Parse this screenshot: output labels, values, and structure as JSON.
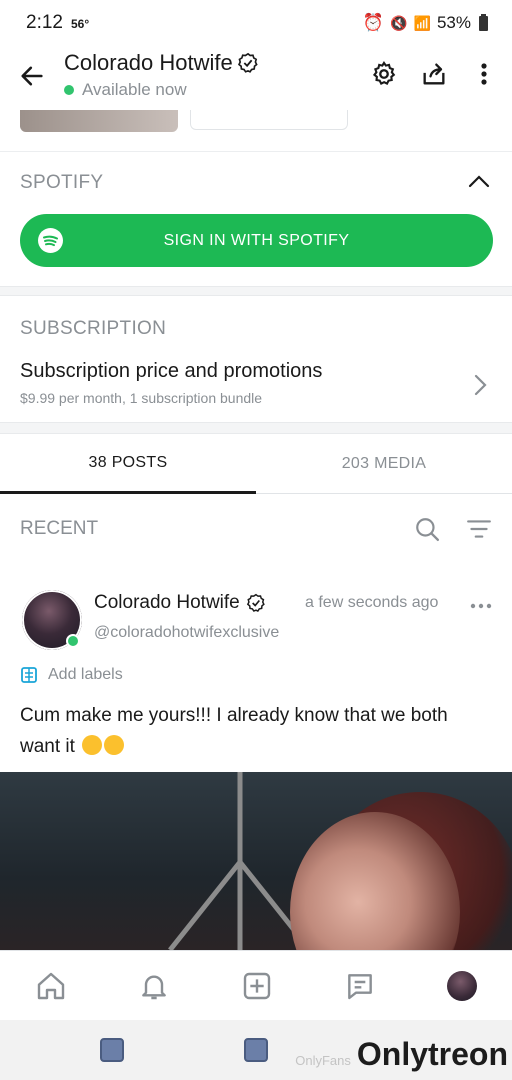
{
  "status_bar": {
    "time": "2:12",
    "temperature": "56°",
    "battery": "53%"
  },
  "header": {
    "title": "Colorado Hotwife",
    "status": "Available now"
  },
  "spotify": {
    "section_label": "SPOTIFY",
    "button_label": "SIGN IN WITH SPOTIFY"
  },
  "subscription": {
    "section_label": "SUBSCRIPTION",
    "title": "Subscription price and promotions",
    "description": "$9.99 per month, 1 subscription bundle"
  },
  "tabs": [
    {
      "label": "38 POSTS",
      "active": true
    },
    {
      "label": "203 MEDIA",
      "active": false
    }
  ],
  "feed": {
    "section_label": "RECENT"
  },
  "post": {
    "author": "Colorado Hotwife",
    "time": "a few seconds ago",
    "handle": "@coloradohotwifexclusive",
    "add_labels": "Add labels",
    "text": "Cum make me yours!!! I already know that we both want it"
  },
  "watermark": {
    "small": "OnlyFans",
    "brand": "Onlytreon"
  },
  "colors": {
    "spotify_green": "#1db954",
    "online_green": "#31c46e",
    "muted_text": "#8a8f94"
  }
}
